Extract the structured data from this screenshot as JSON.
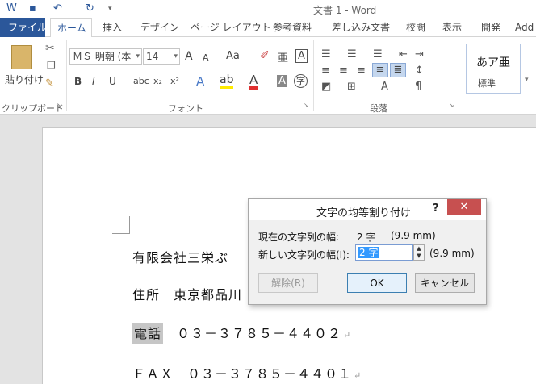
{
  "window": {
    "title": "文書 1 - Word"
  },
  "tabs": [
    {
      "label": "ファイル"
    },
    {
      "label": "ホーム"
    },
    {
      "label": "挿入"
    },
    {
      "label": "デザイン"
    },
    {
      "label": "ページ レイアウト"
    },
    {
      "label": "参考資料"
    },
    {
      "label": "差し込み文書"
    },
    {
      "label": "校閲"
    },
    {
      "label": "表示"
    },
    {
      "label": "開発"
    },
    {
      "label": "Add"
    }
  ],
  "ribbon": {
    "clipboard": {
      "paste_label": "貼り付け",
      "group_label": "クリップボード"
    },
    "font": {
      "font_name": "ＭＳ 明朝 (本",
      "font_size": "14",
      "group_label": "フォント",
      "bold": "B",
      "italic": "I",
      "underline": "U",
      "strike": "abc",
      "sub": "x₂",
      "sup": "x²",
      "grow": "A",
      "shrink": "A",
      "case": "Aa",
      "box_char": "A",
      "ruby": "亜",
      "shade": "A",
      "circle": "字"
    },
    "paragraph": {
      "group_label": "段落"
    },
    "styles": {
      "sample": "あア亜",
      "name": "標準"
    }
  },
  "document": {
    "lines": [
      {
        "text": "有限会社三栄ぶ"
      },
      {
        "text": "住所　東京都品川"
      },
      {
        "text": "電話",
        "rest": "　０３－３７８５－４４０２"
      },
      {
        "text": "ＦＡＸ　０３－３７８５－４４０１"
      }
    ],
    "para_mark": "↵"
  },
  "dialog": {
    "title": "文字の均等割り付け",
    "help": "?",
    "close": "✕",
    "current_label": "現在の文字列の幅:",
    "current_value": "2 字",
    "current_mm": "(9.9 mm)",
    "new_label": "新しい文字列の幅(I):",
    "new_value": "2 字",
    "new_mm": "(9.9 mm)",
    "remove_button": "解除(R)",
    "ok_button": "OK",
    "cancel_button": "キャンセル"
  }
}
